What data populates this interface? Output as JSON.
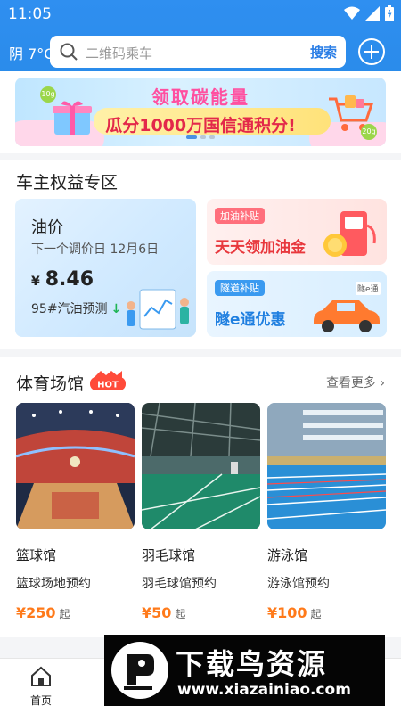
{
  "status": {
    "time": "11:05"
  },
  "header": {
    "weather": "阴 7°C",
    "search_placeholder": "二维码乘车",
    "search_button": "搜索"
  },
  "banner": {
    "line1": "领取碳能量",
    "line2": "瓜分1000万国信通积分!",
    "coin_a": "10g",
    "coin_b": "20g"
  },
  "rights": {
    "title": "车主权益专区",
    "oil": {
      "title": "油价",
      "next_adjust": "下一个调价日 12月6日",
      "currency": "¥",
      "price": "8.46",
      "forecast": "95#汽油预测"
    },
    "subsidy_oil": {
      "tag": "加油补贴",
      "text": "天天领加油金"
    },
    "subsidy_toll": {
      "tag": "隧道补贴",
      "text": "隧e通优惠",
      "sign": "隧e通"
    }
  },
  "venues": {
    "title": "体育场馆",
    "hot_badge": "HOT",
    "more": "查看更多",
    "items": [
      {
        "name": "篮球馆",
        "desc": "篮球场地预约",
        "price": "¥250",
        "suffix": "起"
      },
      {
        "name": "羽毛球馆",
        "desc": "羽毛球馆预约",
        "price": "¥50",
        "suffix": "起"
      },
      {
        "name": "游泳馆",
        "desc": "游泳馆预约",
        "price": "¥100",
        "suffix": "起"
      }
    ]
  },
  "tabbar": {
    "home": "首页"
  },
  "watermark": {
    "text": "下载鸟资源",
    "url": "www.xiazainiao.com"
  },
  "colors": {
    "brand_blue": "#2f8ff0",
    "price_orange": "#ff7a1a",
    "hot_red": "#ff4b3a"
  },
  "icons": [
    "search-icon",
    "wifi-icon",
    "signal-icon",
    "battery-icon",
    "add-icon",
    "chevron-right-icon",
    "home-icon",
    "down-arrow-icon"
  ]
}
